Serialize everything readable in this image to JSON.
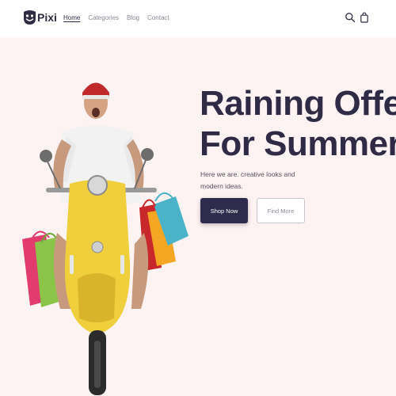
{
  "brand": {
    "name": "Pixi"
  },
  "nav": {
    "items": [
      {
        "label": "Home",
        "active": true
      },
      {
        "label": "Categories",
        "active": false
      },
      {
        "label": "Blog",
        "active": false
      },
      {
        "label": "Contact",
        "active": false
      }
    ]
  },
  "header_icons": {
    "search": "search-icon",
    "cart": "shopping-bag-icon"
  },
  "hero": {
    "title_line1": "Raining Offers",
    "title_line2": "For Summer!",
    "subtitle": "Here we are. creative looks and modern ideas.",
    "primary_button": "Shop Now",
    "secondary_button": "Find More"
  },
  "colors": {
    "brand_dark": "#2e2c4d",
    "hero_background": "#fdf3f3",
    "scooter_yellow": "#efcf3c",
    "helmet_red": "#c0282a"
  }
}
